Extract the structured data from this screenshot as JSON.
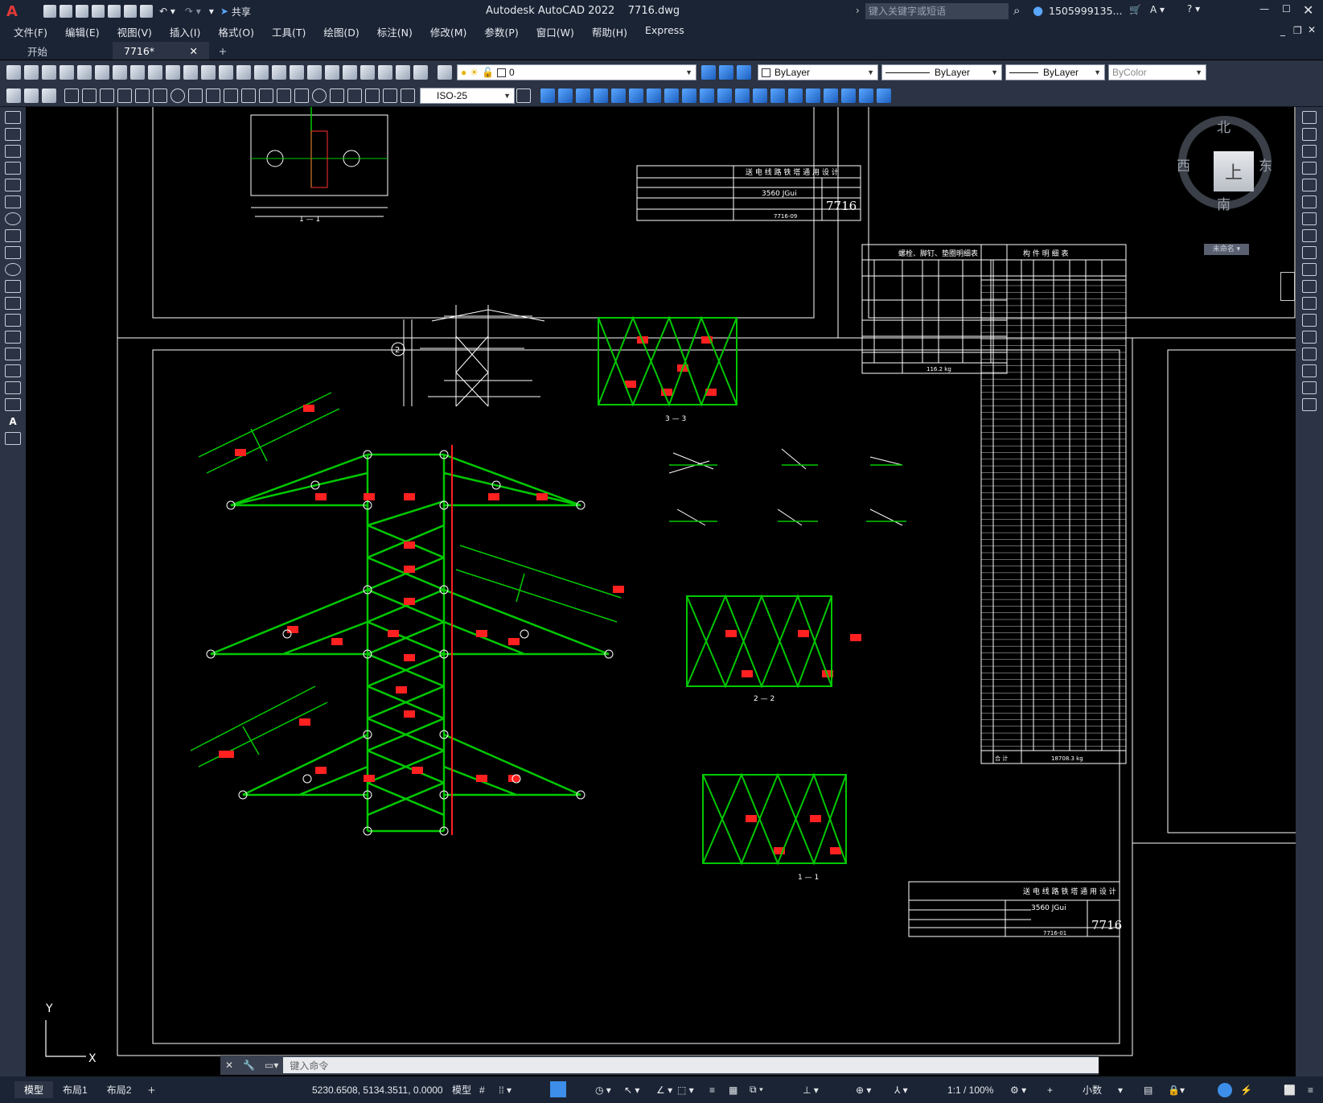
{
  "app": {
    "title": "Autodesk AutoCAD 2022    7716.dwg",
    "share": "共享",
    "search_placeholder": "键入关键字或短语",
    "user": "1505999135...",
    "menus": [
      "文件(F)",
      "编辑(E)",
      "视图(V)",
      "插入(I)",
      "格式(O)",
      "工具(T)",
      "绘图(D)",
      "标注(N)",
      "修改(M)",
      "参数(P)",
      "窗口(W)",
      "帮助(H)",
      "Express"
    ]
  },
  "tabs": {
    "start": "开始",
    "doc": "7716*"
  },
  "toolbar": {
    "layer": "0",
    "color": "ByLayer",
    "linetype": "ByLayer",
    "lineweight": "ByLayer",
    "plotstyle": "ByColor",
    "dimstyle": "ISO-25"
  },
  "viewcube": {
    "north": "北",
    "south": "南",
    "east": "东",
    "west": "西",
    "top": "上",
    "ucs": "未命名"
  },
  "drawing": {
    "table1_title": "螺栓、脚钉、垫圈明细表",
    "table2_title": "构 件 明 细 表",
    "titleblock_header": "送 电 线 路 铁 塔 通 用 设 计",
    "drawing_no": "7716",
    "tower_name": "3560 JGui",
    "sheet_no": "7716-01",
    "sheet_no_top": "7716-09",
    "total_label": "合 计",
    "total_weight": "18708.3 kg",
    "small_total": "116.2 kg",
    "section_1": "1 — 1",
    "section_2": "2 — 2",
    "section_3": "3 — 3",
    "circle_2": "2"
  },
  "axes": {
    "y": "Y",
    "x": "X"
  },
  "command": {
    "placeholder": "键入命令"
  },
  "status": {
    "layout_tabs": [
      "模型",
      "布局1",
      "布局2"
    ],
    "coords": "5230.6508, 5134.3511, 0.0000",
    "mode": "模型",
    "scale": "1:1 / 100%",
    "units": "小数"
  },
  "colors": {
    "bg": "#000000",
    "frame": "#ffffff",
    "steel": "#00c800",
    "annotation": "#ff2020",
    "ui": "#1b2434"
  }
}
